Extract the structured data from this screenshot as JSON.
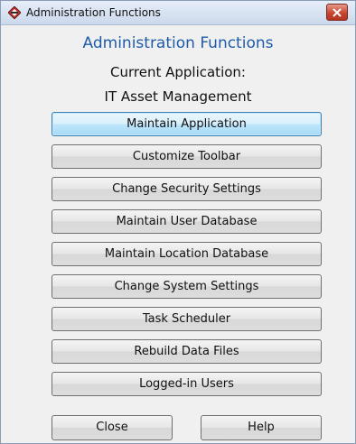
{
  "window": {
    "title": "Administration Functions",
    "title_icon": "app-diamond-icon",
    "close_icon": "close-icon",
    "close_color": "#c8452f"
  },
  "dialog": {
    "heading": "Administration Functions",
    "current_label": "Current Application:",
    "application_name": "IT Asset Management",
    "heading_color": "#1f5ba8"
  },
  "buttons": [
    {
      "label": "Maintain Application"
    },
    {
      "label": "Customize Toolbar"
    },
    {
      "label": "Change Security Settings"
    },
    {
      "label": "Maintain User Database"
    },
    {
      "label": "Maintain Location Database"
    },
    {
      "label": "Change System Settings"
    },
    {
      "label": "Task Scheduler"
    },
    {
      "label": "Rebuild Data Files"
    },
    {
      "label": "Logged-in Users"
    }
  ],
  "footer": {
    "close_label": "Close",
    "help_label": "Help"
  }
}
